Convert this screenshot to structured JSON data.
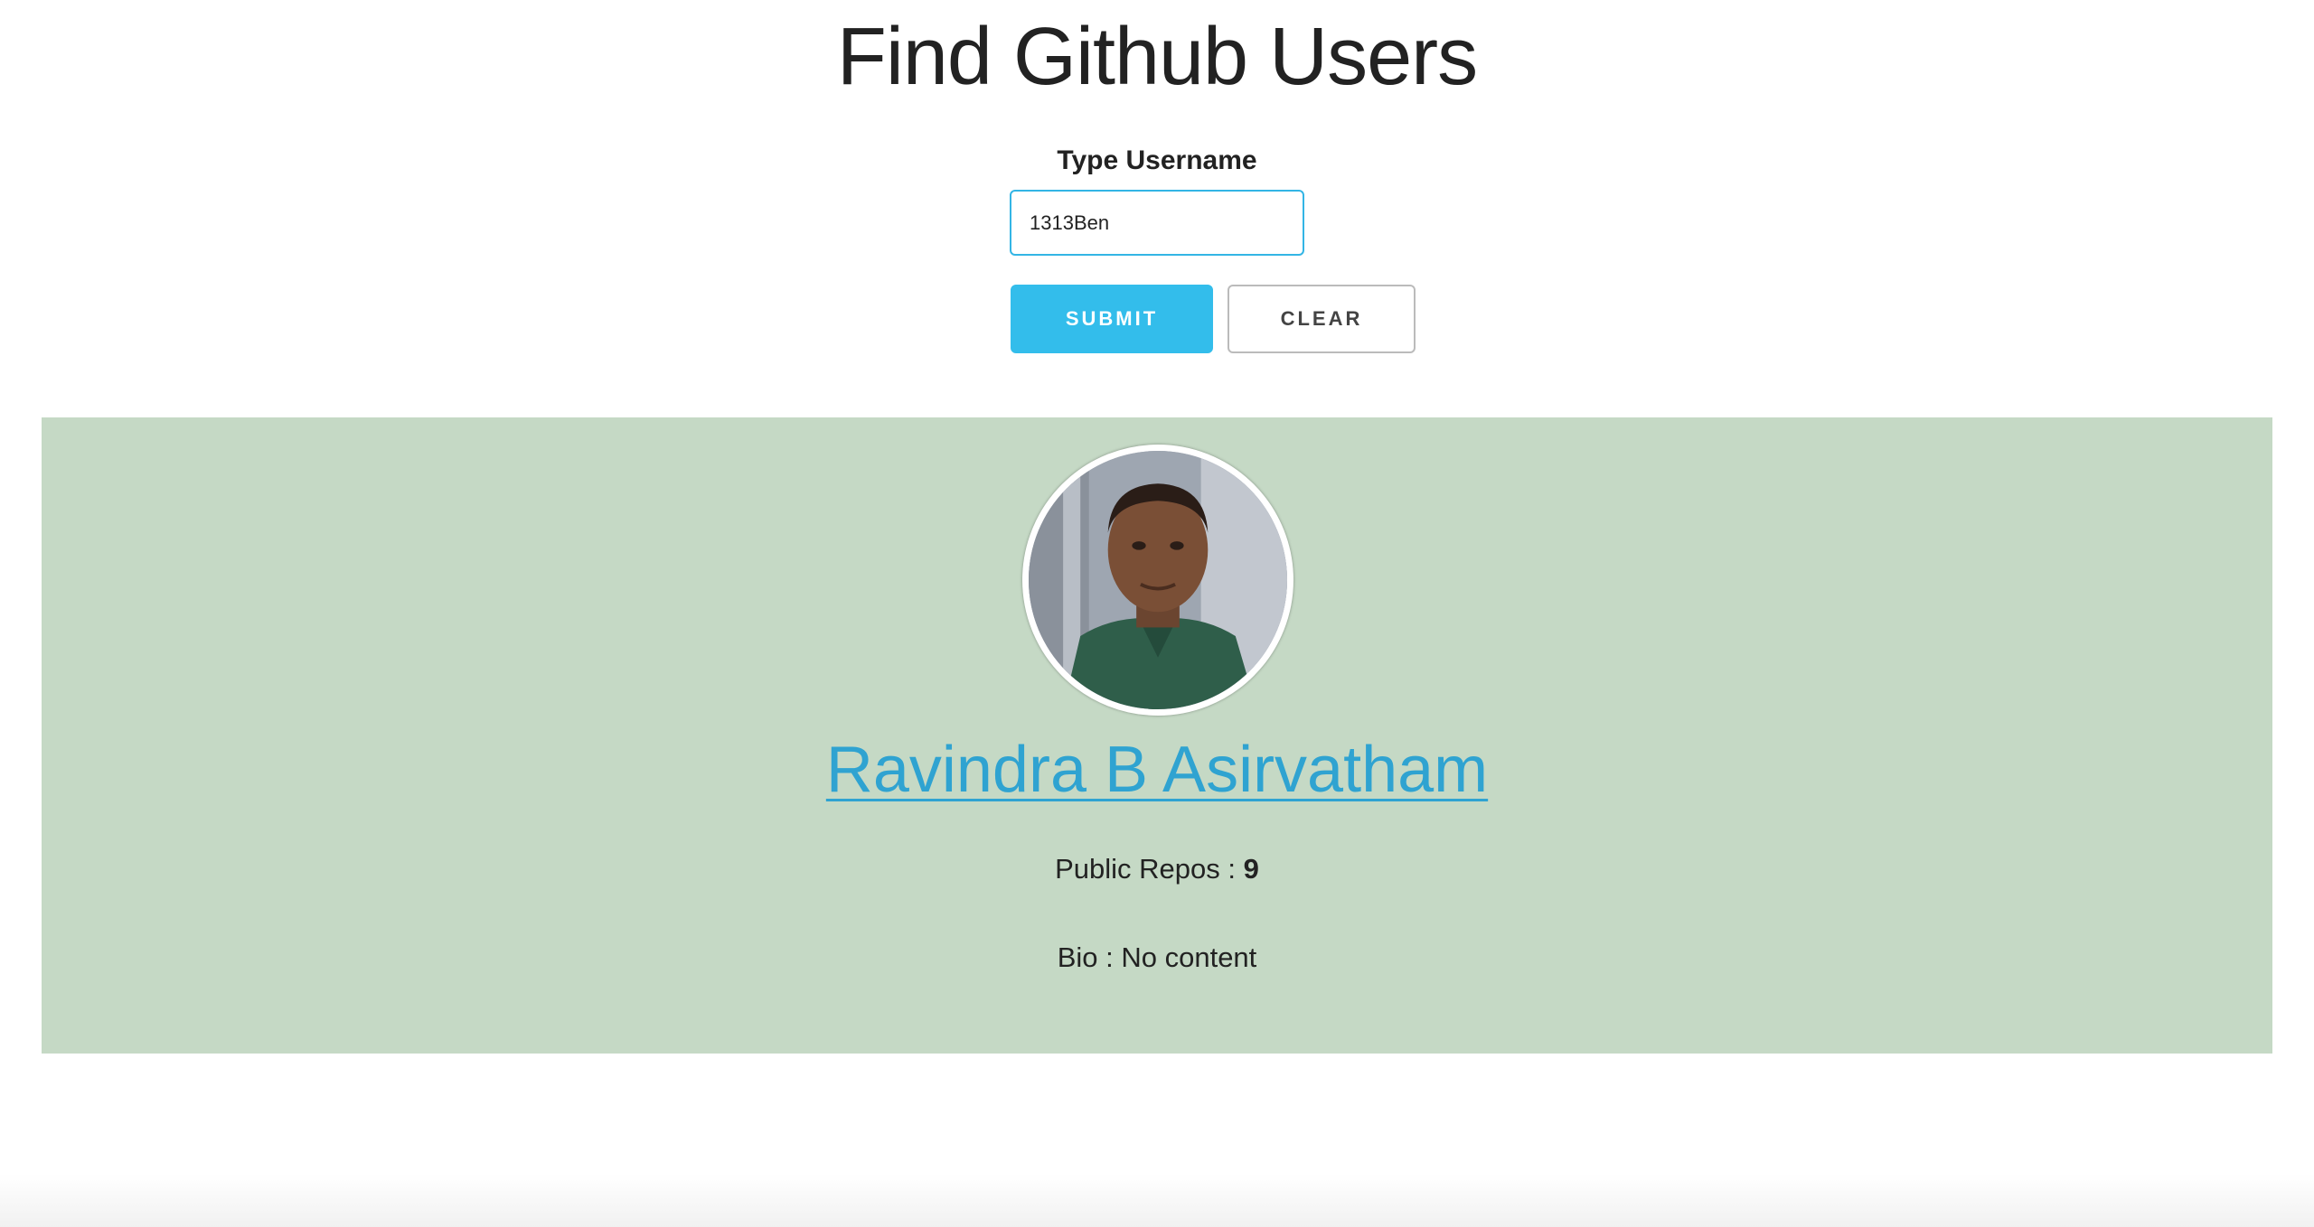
{
  "header": {
    "title": "Find Github Users"
  },
  "search": {
    "label": "Type Username",
    "value": "1313Ben",
    "placeholder": "",
    "submit_label": "SUBMIT",
    "clear_label": "CLEAR"
  },
  "user": {
    "avatar_icon": "avatar-photo",
    "name": "Ravindra B Asirvatham",
    "repos_label": "Public Repos :",
    "repos_count": "9",
    "bio_label": "Bio :",
    "bio_value": "No content"
  },
  "colors": {
    "accent": "#33bdeb",
    "link": "#2fa3d1",
    "card_background": "#c5d9c5"
  }
}
